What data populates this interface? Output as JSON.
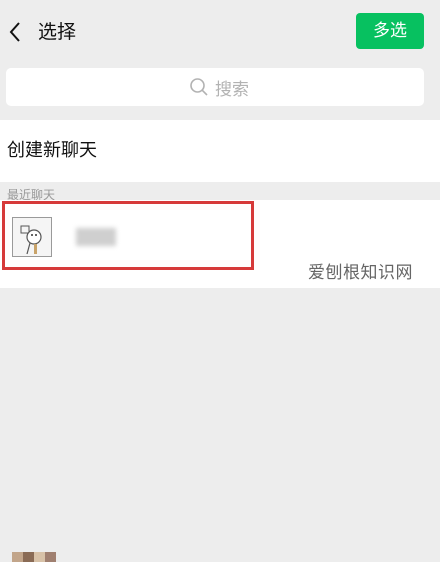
{
  "header": {
    "back_icon": "chevron-left-icon",
    "title": "选择",
    "multi_select_label": "多选",
    "accent": "#07c160"
  },
  "search": {
    "icon": "search-icon",
    "placeholder": "搜索"
  },
  "new_chat": {
    "label": "创建新聊天"
  },
  "recent": {
    "section_label": "最近聊天",
    "items": [
      {
        "avatar": "avatar-image",
        "name_blurred": true,
        "highlighted": true,
        "highlight_color": "#d63a3a"
      }
    ]
  },
  "watermark": "爱刨根知识网"
}
